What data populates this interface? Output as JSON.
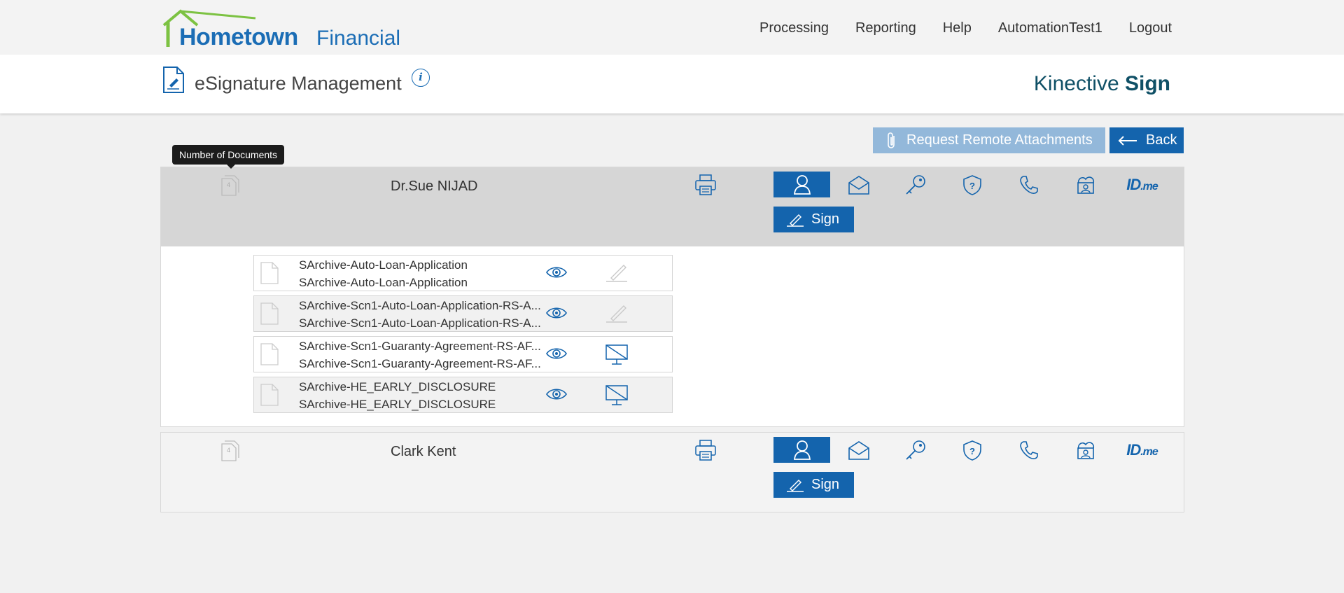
{
  "header": {
    "logo_main": "Hometown",
    "logo_sub": "Financial",
    "nav": [
      "Processing",
      "Reporting",
      "Help",
      "AutomationTest1",
      "Logout"
    ]
  },
  "subheader": {
    "title": "eSignature Management",
    "info_glyph": "i",
    "brand_light": "Kinective ",
    "brand_bold": "Sign"
  },
  "actions": {
    "attach_label": "Request Remote Attachments",
    "back_label": "Back"
  },
  "tooltip": "Number of Documents",
  "signers": [
    {
      "name": "Dr.Sue NIJAD",
      "doc_count": "4",
      "sign_label": "Sign",
      "idme": "ID",
      "idme_suffix": ".me",
      "documents": [
        {
          "line1": "SArchive-Auto-Loan-Application",
          "line2": "SArchive-Auto-Loan-Application",
          "status": "pen-disabled-icon"
        },
        {
          "line1": "SArchive-Scn1-Auto-Loan-Application-RS-A...",
          "line2": "SArchive-Scn1-Auto-Loan-Application-RS-A...",
          "status": "pen-disabled-icon"
        },
        {
          "line1": "SArchive-Scn1-Guaranty-Agreement-RS-AF...",
          "line2": "SArchive-Scn1-Guaranty-Agreement-RS-AF...",
          "status": "no-presentation-icon"
        },
        {
          "line1": "SArchive-HE_EARLY_DISCLOSURE",
          "line2": "SArchive-HE_EARLY_DISCLOSURE",
          "status": "no-presentation-icon"
        }
      ]
    },
    {
      "name": "Clark Kent",
      "doc_count": "4",
      "sign_label": "Sign",
      "idme": "ID",
      "idme_suffix": ".me"
    }
  ],
  "colors": {
    "primary": "#1464ad",
    "primary_light": "#93b8da",
    "logo_green": "#7cc242"
  }
}
